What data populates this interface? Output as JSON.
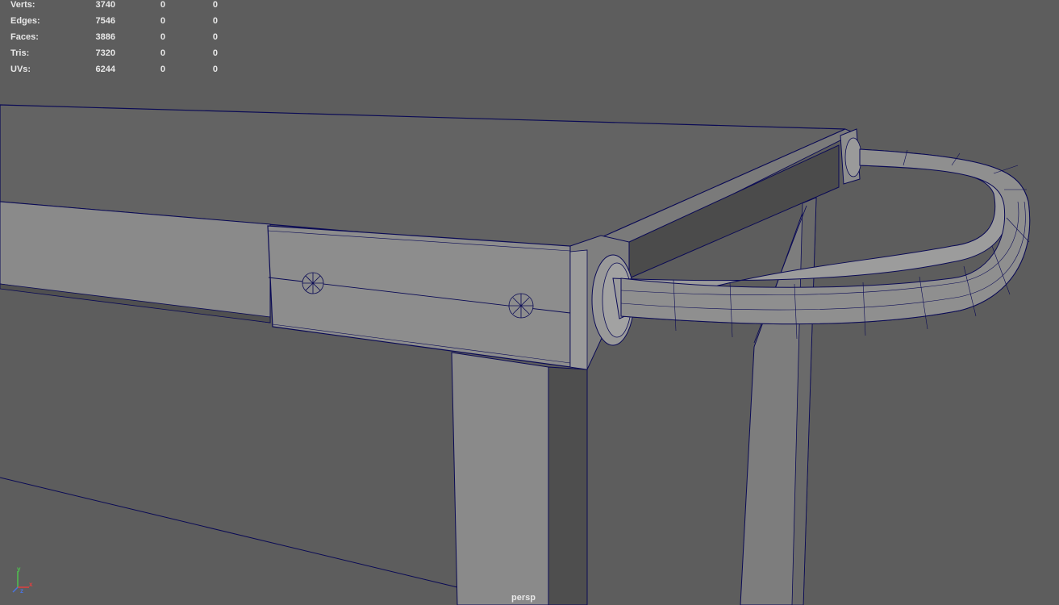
{
  "viewport": {
    "camera": "persp",
    "background_color": "#5d5d5d",
    "wire_color": "#0a0a55"
  },
  "hud": {
    "rows": [
      {
        "label": "Verts:",
        "total": "3740",
        "selected": "0",
        "shaded": "0"
      },
      {
        "label": "Edges:",
        "total": "7546",
        "selected": "0",
        "shaded": "0"
      },
      {
        "label": "Faces:",
        "total": "3886",
        "selected": "0",
        "shaded": "0"
      },
      {
        "label": "Tris:",
        "total": "7320",
        "selected": "0",
        "shaded": "0"
      },
      {
        "label": "UVs:",
        "total": "6244",
        "selected": "0",
        "shaded": "0"
      }
    ]
  },
  "axis_gizmo": {
    "x": "x",
    "y": "y",
    "z": "z"
  }
}
